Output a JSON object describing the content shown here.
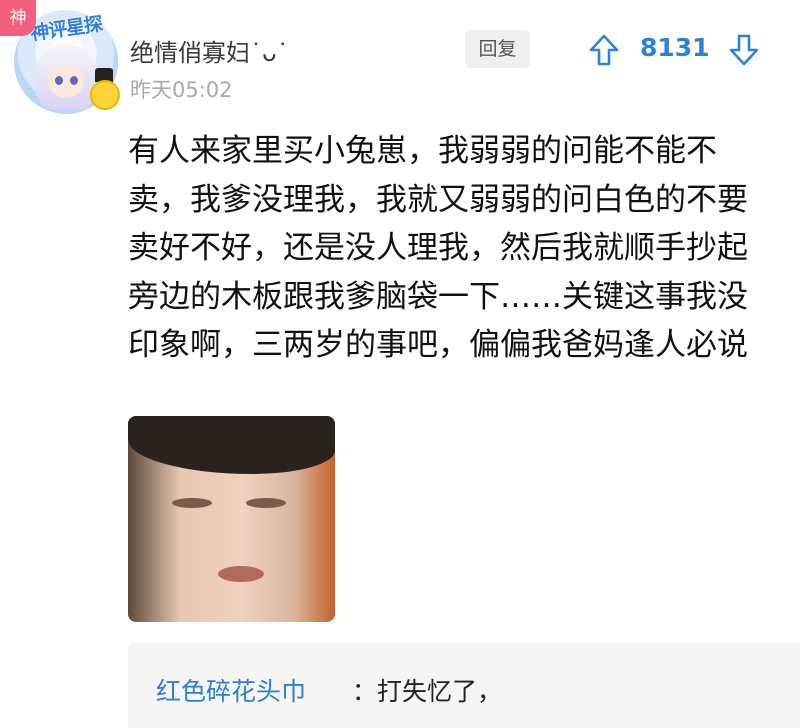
{
  "post": {
    "badge": "神",
    "avatar_text": "神评星探",
    "username": "绝情俏寡妇˙ᴗ˙",
    "timestamp": "昨天05:02",
    "reply_label": "回复",
    "vote_count": "8131",
    "content": "有人来家里买小兔崽，我弱弱的问能不能不卖，我爹没理我，我就又弱弱的问白色的不要卖好不好，还是没人理我，然后我就顺手抄起旁边的木板跟我爹脑袋一下……关键这事我没印象啊，三两岁的事吧，偏偏我爸妈逢人必说"
  },
  "reply": {
    "user": "红色碎花头巾",
    "separator": "：",
    "text": "打失忆了，"
  },
  "colors": {
    "accent": "#2c82d9",
    "badge": "#f2607e"
  }
}
